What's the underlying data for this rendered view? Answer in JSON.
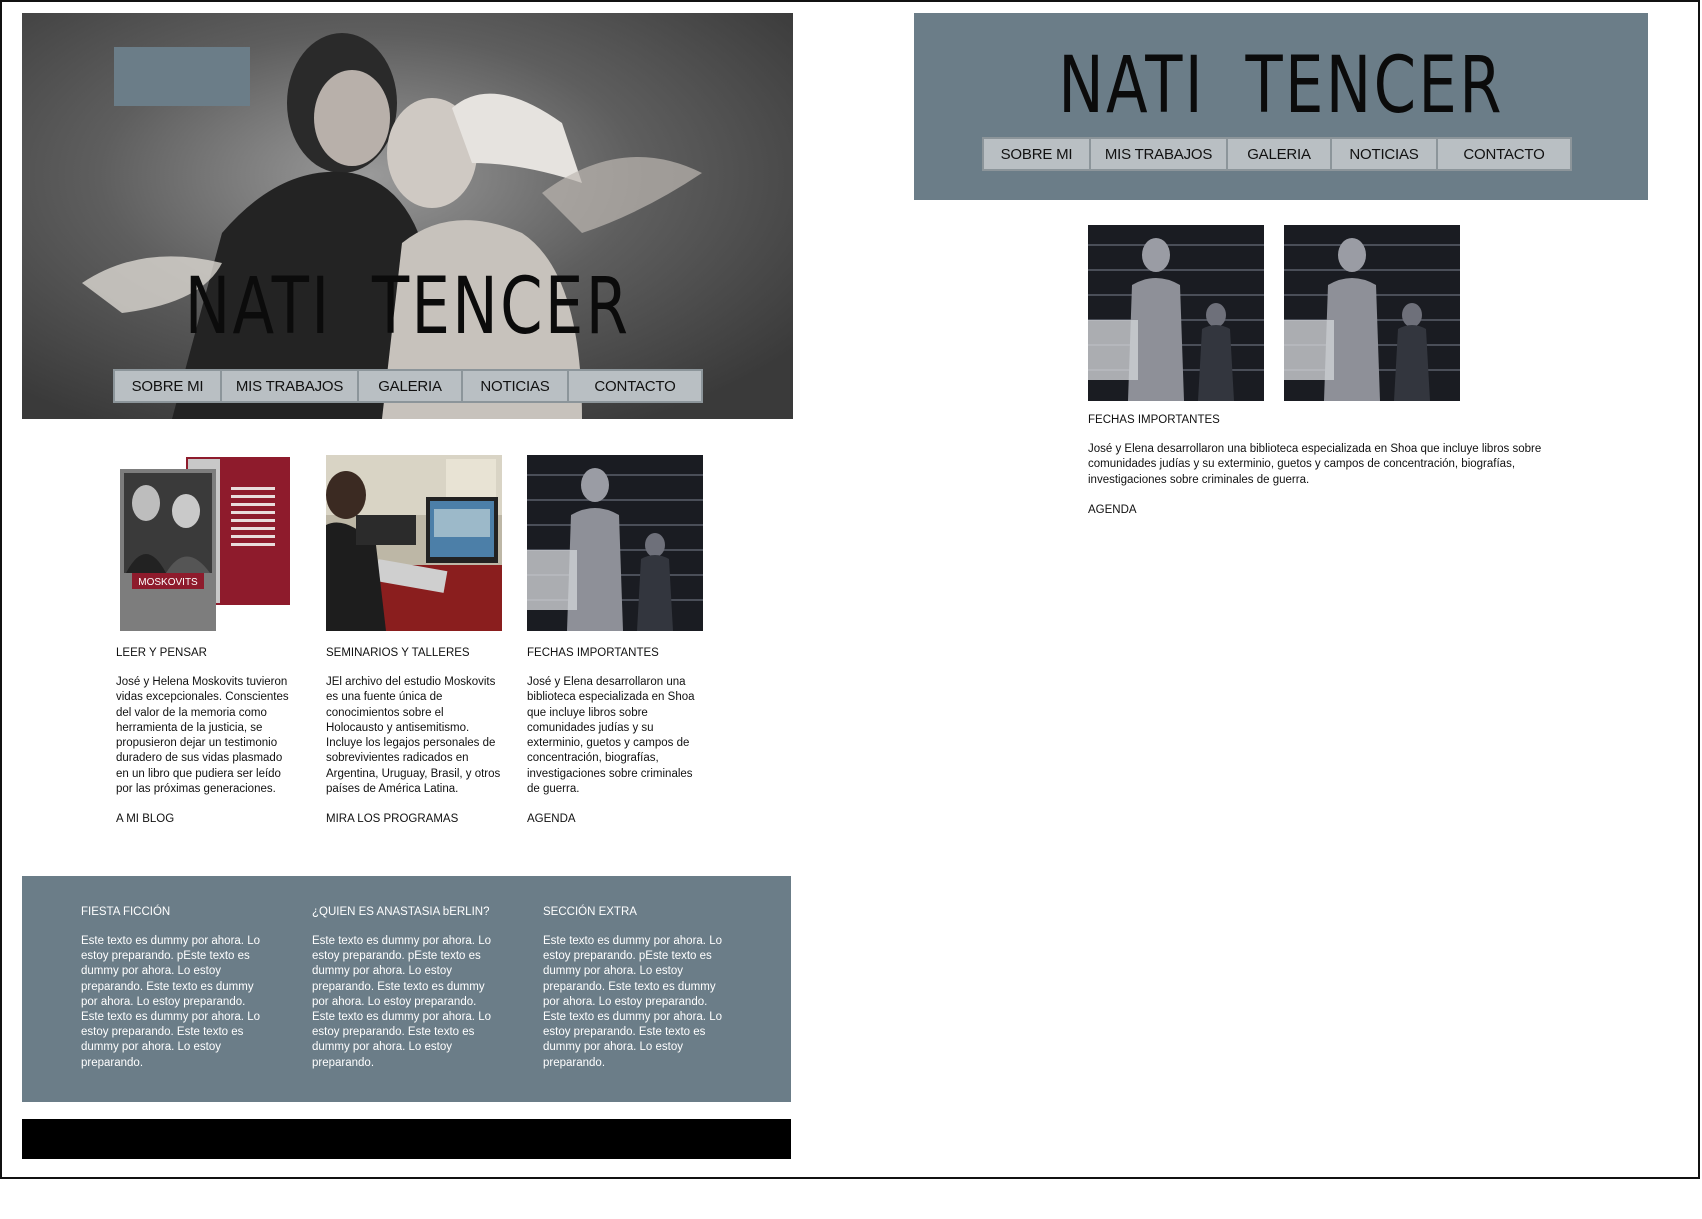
{
  "site": {
    "title": "NATI  TENCER",
    "nav": [
      "SOBRE MI",
      "MIS TRABAJOS",
      "GALERIA",
      "NOTICIAS",
      "CONTACTO"
    ]
  },
  "cards": [
    {
      "heading": "LEER Y PENSAR",
      "body": "José y Helena Moskovits tuvieron vidas excepcionales. Conscientes del valor de la memoria como herramienta de la justicia, se propusieron dejar un testimonio duradero de sus vidas plasmado en un libro que pudiera ser leído por las próximas generaciones.",
      "link": "A MI BLOG",
      "book_cover_text": "MOSKOVITS"
    },
    {
      "heading": "SEMINARIOS Y TALLERES",
      "body": "JEl archivo del estudio Moskovits es una fuente única de conocimientos sobre el Holocausto y antisemitismo. Incluye los legajos personales de sobrevivientes radicados en Argentina, Uruguay, Brasil, y otros países de América Latina.",
      "link": "MIRA LOS PROGRAMAS"
    },
    {
      "heading": "FECHAS IMPORTANTES",
      "body": "José y Elena desarrollaron una biblioteca especializada en Shoa que incluye libros sobre comunidades judías y su exterminio, guetos y campos de concentración, biografías, investigaciones sobre  criminales de guerra.",
      "link": "AGENDA"
    }
  ],
  "footer": [
    {
      "heading": "FIESTA FICCIÓN",
      "body": "Este texto es dummy por ahora. Lo estoy preparando. pEste texto es dummy por ahora. Lo estoy preparando. Este texto es dummy por ahora. Lo estoy preparando. Este texto es dummy por ahora. Lo estoy preparando.  Este texto es dummy por ahora. Lo estoy preparando."
    },
    {
      "heading": "¿QUIEN ES ANASTASIA bERLIN?",
      "body": "Este texto es dummy por ahora. Lo estoy preparando. pEste texto es dummy por ahora. Lo estoy preparando. Este texto es dummy por ahora. Lo estoy preparando. Este texto es dummy por ahora. Lo estoy preparando.  Este texto es dummy por ahora. Lo estoy preparando."
    },
    {
      "heading": "SECCIÓN EXTRA",
      "body": "Este texto es dummy por ahora. Lo estoy preparando. pEste texto es dummy por ahora. Lo estoy preparando. Este texto es dummy por ahora. Lo estoy preparando. Este texto es dummy por ahora. Lo estoy preparando.  Este texto es dummy por ahora. Lo estoy preparando."
    }
  ],
  "detail": {
    "heading": "FECHAS IMPORTANTES",
    "body": "José y Elena desarrollaron una biblioteca especializada en Shoa que incluye libros sobre comunidades judías y su exterminio, guetos y campos de concentración, biografías, investigaciones sobre  criminales de guerra.",
    "link": "AGENDA"
  },
  "colors": {
    "slate": "#6b7d88",
    "nav_bg": "#b9bfc3",
    "black": "#000000",
    "book_red": "#8e1b2c"
  }
}
